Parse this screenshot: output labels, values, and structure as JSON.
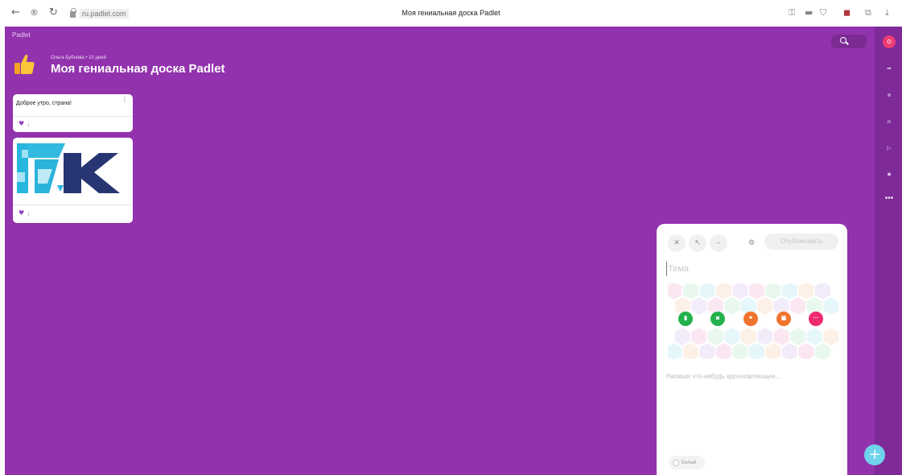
{
  "browser": {
    "back_icon": "←",
    "forward_icon": "®",
    "reload_icon": "↻",
    "url": "ru.padlet.com",
    "tab_title": "Моя гениальная доска Padlet"
  },
  "board": {
    "logo": "Padlet",
    "author_meta": "Ольга Бубнова • 10 дней",
    "title": "Моя гениальная доска Padlet",
    "background_color": "#9232ad"
  },
  "posts": [
    {
      "text": "Доброе утро, страна!",
      "likes": "1"
    },
    {
      "image_alt": "KTK logo",
      "likes": "1"
    }
  ],
  "compose": {
    "publish_label": "Опубликовать",
    "subject_placeholder": "Тема",
    "body_placeholder": "Напиши что-нибудь вдохновляющее...",
    "color_label": "Белый",
    "attachments": [
      {
        "icon": "upload-icon",
        "color": "#23b14d"
      },
      {
        "icon": "camera-icon",
        "color": "#23b14d"
      },
      {
        "icon": "link-icon",
        "color": "#f0742e"
      },
      {
        "icon": "image-search-icon",
        "color": "#f0742e"
      },
      {
        "icon": "more-icon",
        "color": "#ee2a70"
      }
    ]
  },
  "sidebar": {
    "avatar_letter": "О",
    "more": "•••"
  },
  "fab_label": "+"
}
